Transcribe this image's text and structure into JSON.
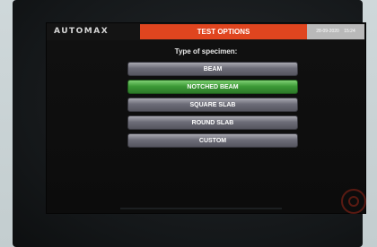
{
  "header": {
    "logo": "AUTOMAX",
    "title": "TEST OPTIONS",
    "date": "28-09-2020",
    "time": "15:24"
  },
  "prompt": "Type of specimen:",
  "options": [
    {
      "label": "BEAM",
      "selected": false
    },
    {
      "label": "NOTCHED BEAM",
      "selected": true
    },
    {
      "label": "SQUARE SLAB",
      "selected": false
    },
    {
      "label": "ROUND SLAB",
      "selected": false
    },
    {
      "label": "CUSTOM",
      "selected": false
    }
  ],
  "colors": {
    "title_tab": "#e0451f",
    "selected_option": "#3d9b37",
    "option": "#6d6d78"
  }
}
